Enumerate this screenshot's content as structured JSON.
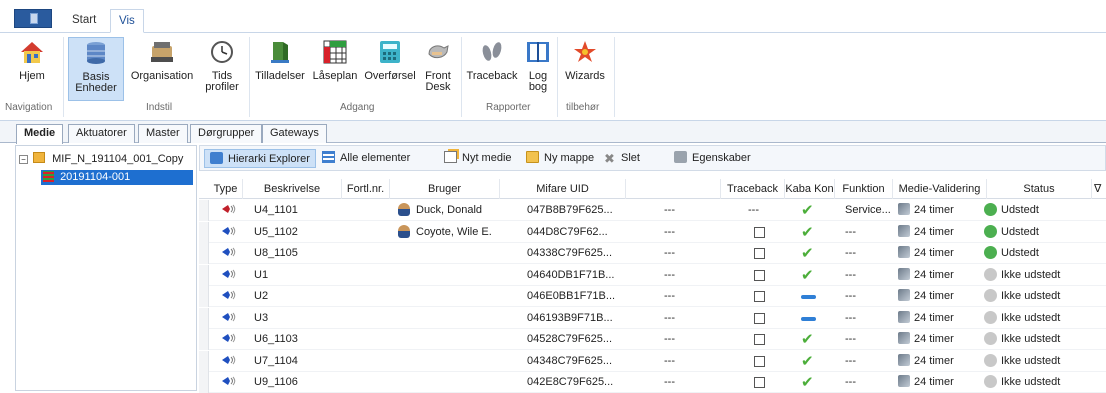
{
  "ribbon_tabs": {
    "start": "Start",
    "vis": "Vis"
  },
  "ribbon": {
    "buttons": {
      "hjem": "Hjem",
      "basis_1": "Basis",
      "basis_2": "Enheder",
      "organisation": "Organisation",
      "tids_1": "Tids",
      "tids_2": "profiler",
      "tilladelser": "Tilladelser",
      "laaseplan": "Låseplan",
      "overforsel": "Overførsel",
      "front_1": "Front",
      "front_2": "Desk",
      "traceback": "Traceback",
      "log_1": "Log",
      "log_2": "bog",
      "wizards": "Wizards"
    },
    "groups": {
      "navigation": "Navigation",
      "indstil": "Indstil",
      "adgang": "Adgang",
      "rapporter": "Rapporter",
      "tilbehor": "tilbehør"
    }
  },
  "sub_tabs": [
    "Medie",
    "Aktuatorer",
    "Master",
    "Dørgrupper",
    "Gateways"
  ],
  "tree": {
    "root": "MIF_N_191104_001_Copy",
    "child": "20191104-001"
  },
  "toolbar": {
    "hierarki": "Hierarki Explorer",
    "alle": "Alle elementer",
    "nyt_medie": "Nyt medie",
    "ny_mappe": "Ny mappe",
    "slet": "Slet",
    "egenskaber": "Egenskaber"
  },
  "columns": [
    "Type",
    "Beskrivelse",
    "Fortl.nr.",
    "Bruger",
    "Mifare UID",
    "",
    "Traceback",
    "Kaba Kon",
    "Funktion",
    "Medie-Validering",
    "Status"
  ],
  "rows": [
    {
      "type_color": "#c0202a",
      "beskrivelse": "U4_1101",
      "bruger": "Duck, Donald",
      "uid": "047B8B79F625...",
      "dash": "---",
      "traceback": "---",
      "kaba": "check",
      "funktion": "Service...",
      "validering": "24 timer",
      "status": "Udstedt",
      "issued": true
    },
    {
      "type_color": "#1f4fbf",
      "beskrivelse": "U5_1102",
      "bruger": "Coyote, Wile E.",
      "uid": "044D8C79F62...",
      "dash": "---",
      "traceback": "box",
      "kaba": "check",
      "funktion": "---",
      "validering": "24 timer",
      "status": "Udstedt",
      "issued": true
    },
    {
      "type_color": "#1f4fbf",
      "beskrivelse": "U8_1105",
      "bruger": "",
      "uid": "04338C79F625...",
      "dash": "---",
      "traceback": "box",
      "kaba": "check",
      "funktion": "---",
      "validering": "24 timer",
      "status": "Udstedt",
      "issued": true
    },
    {
      "type_color": "#1f4fbf",
      "beskrivelse": "U1",
      "bruger": "",
      "uid": "04640DB1F71B...",
      "dash": "---",
      "traceback": "box",
      "kaba": "check",
      "funktion": "---",
      "validering": "24 timer",
      "status": "Ikke udstedt",
      "issued": false
    },
    {
      "type_color": "#1f4fbf",
      "beskrivelse": "U2",
      "bruger": "",
      "uid": "046E0BB1F71B...",
      "dash": "---",
      "traceback": "box",
      "kaba": "dash",
      "funktion": "---",
      "validering": "24 timer",
      "status": "Ikke udstedt",
      "issued": false
    },
    {
      "type_color": "#1f4fbf",
      "beskrivelse": "U3",
      "bruger": "",
      "uid": "046193B9F71B...",
      "dash": "---",
      "traceback": "box",
      "kaba": "dash",
      "funktion": "---",
      "validering": "24 timer",
      "status": "Ikke udstedt",
      "issued": false
    },
    {
      "type_color": "#1f4fbf",
      "beskrivelse": "U6_1103",
      "bruger": "",
      "uid": "04528C79F625...",
      "dash": "---",
      "traceback": "box",
      "kaba": "check",
      "funktion": "---",
      "validering": "24 timer",
      "status": "Ikke udstedt",
      "issued": false
    },
    {
      "type_color": "#1f4fbf",
      "beskrivelse": "U7_1104",
      "bruger": "",
      "uid": "04348C79F625...",
      "dash": "---",
      "traceback": "box",
      "kaba": "check",
      "funktion": "---",
      "validering": "24 timer",
      "status": "Ikke udstedt",
      "issued": false
    },
    {
      "type_color": "#1f4fbf",
      "beskrivelse": "U9_1106",
      "bruger": "",
      "uid": "042E8C79F625...",
      "dash": "---",
      "traceback": "box",
      "kaba": "check",
      "funktion": "---",
      "validering": "24 timer",
      "status": "Ikke udstedt",
      "issued": false
    }
  ],
  "colors": {
    "accent": "#1d4f97",
    "issued": "#4caf50",
    "not_issued": "#c8c8c8",
    "check": "#4cae3a",
    "kaba_dash": "#2f7fd6"
  }
}
